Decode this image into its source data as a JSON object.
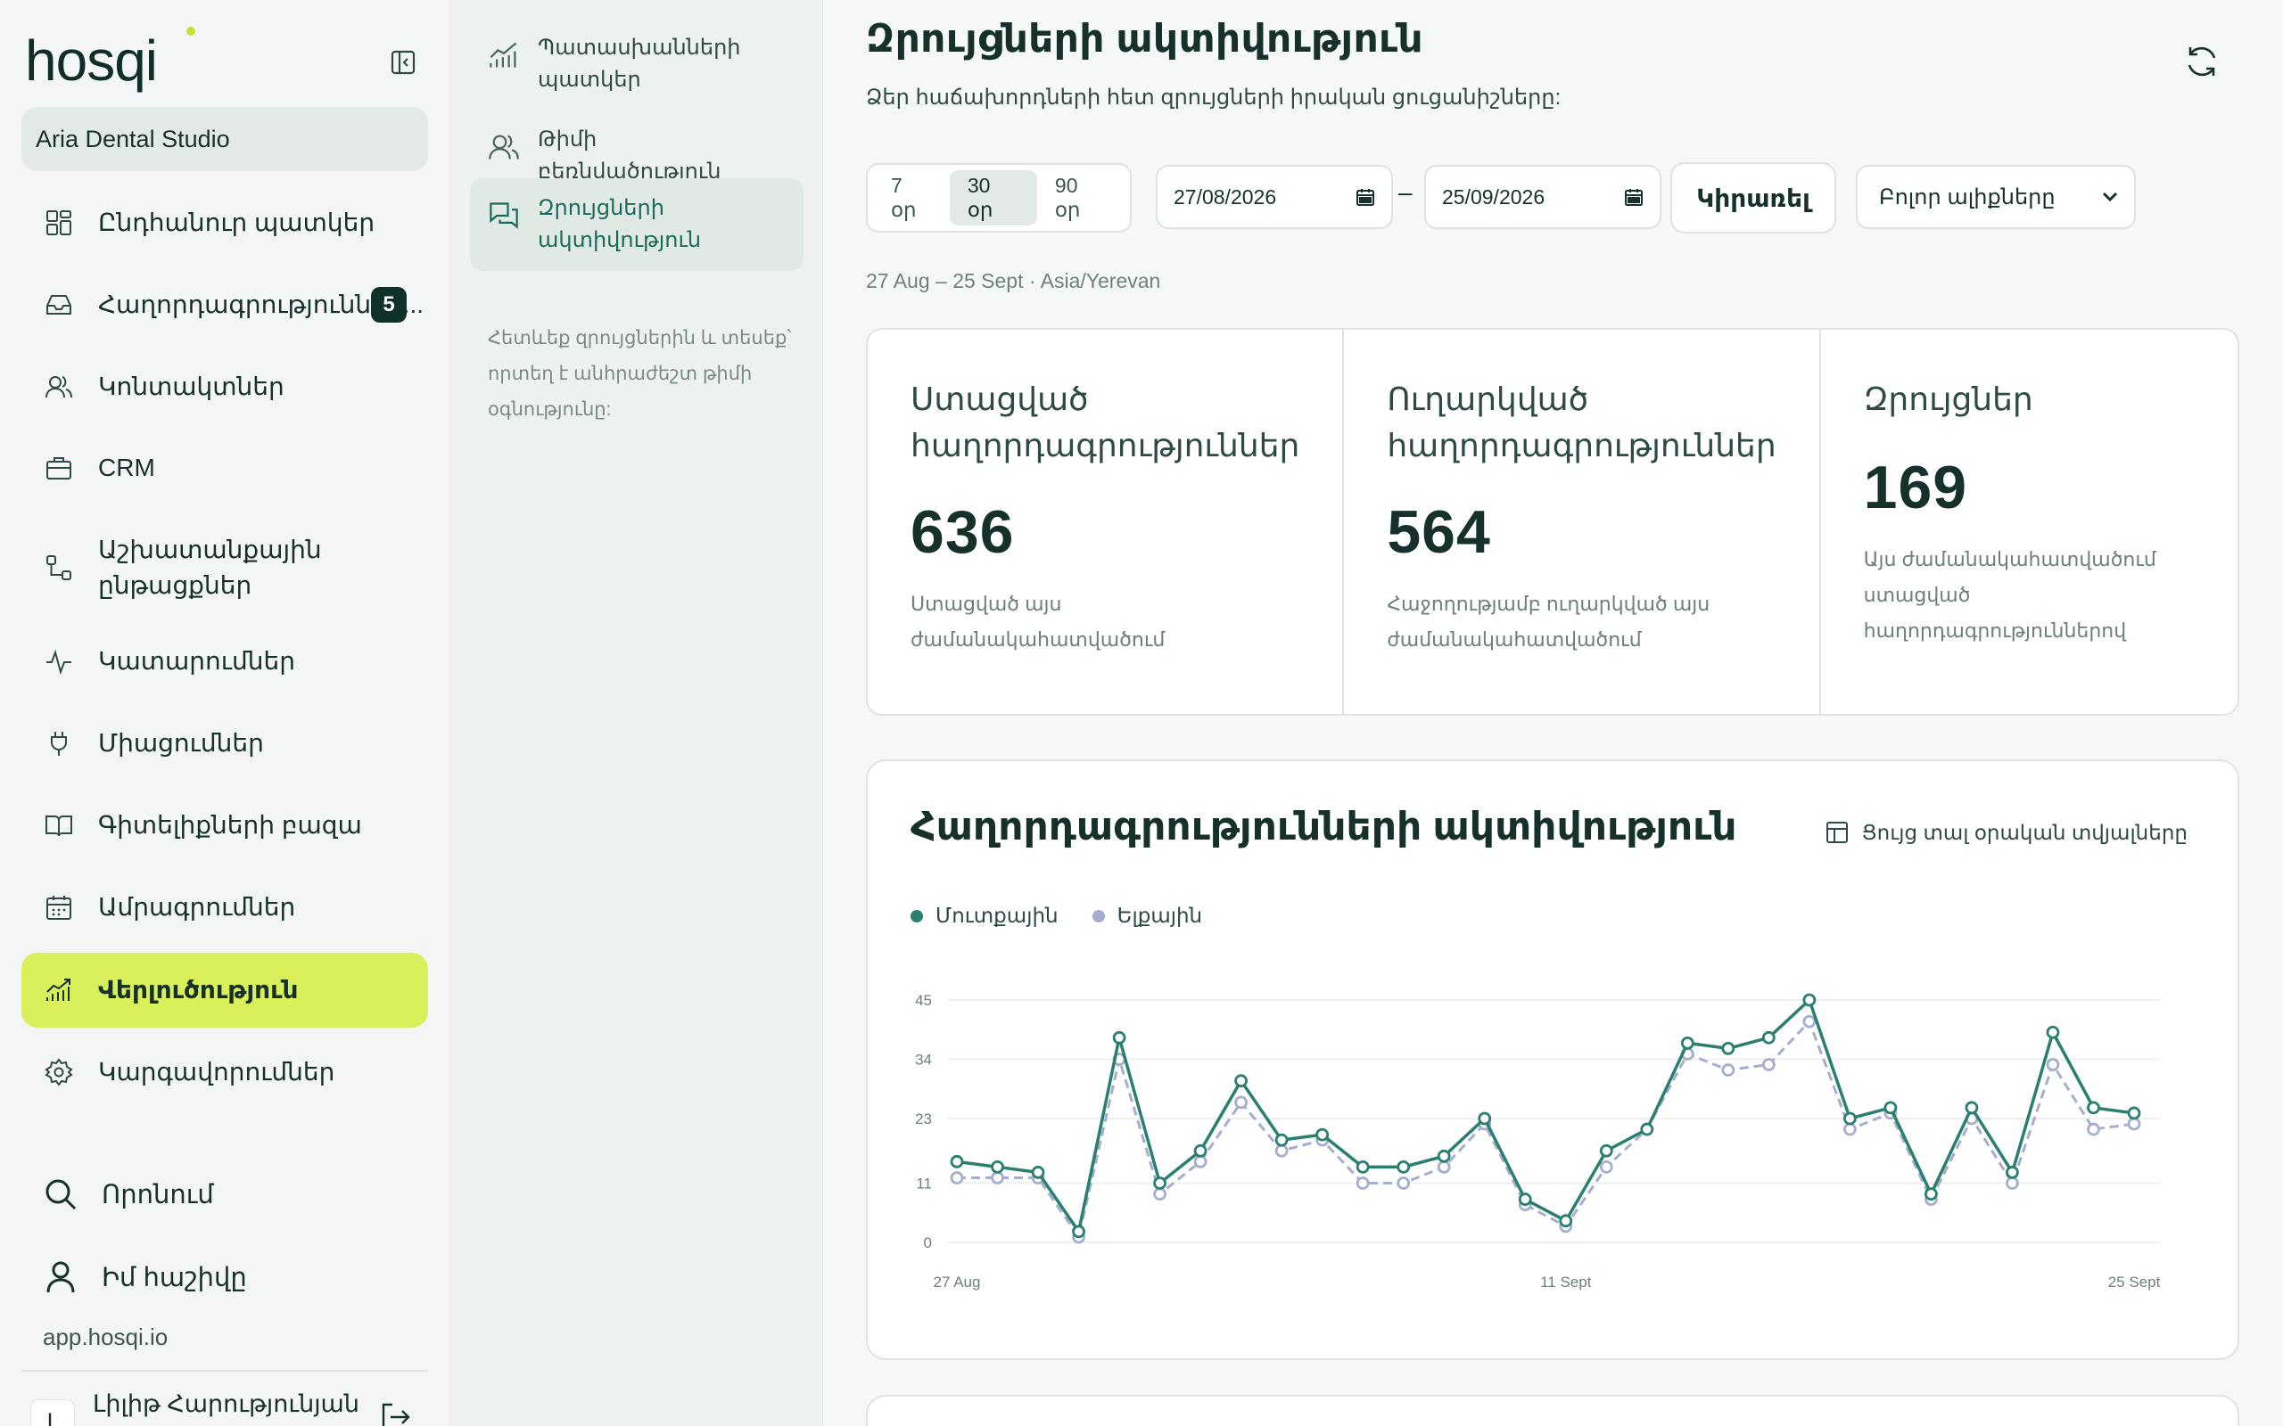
{
  "app": {
    "logo_text": "hosqi",
    "domain": "app.hosqi.io"
  },
  "workspace": {
    "name": "Aria Dental Studio"
  },
  "nav": {
    "items": [
      {
        "label": "Ընդհանուր պատկեր",
        "icon": "grid-icon"
      },
      {
        "label": "Հաղորդագրություններ...",
        "icon": "inbox-icon",
        "badge": "5"
      },
      {
        "label": "Կոնտակտներ",
        "icon": "users-icon"
      },
      {
        "label": "CRM",
        "icon": "briefcase-icon"
      },
      {
        "label": "Աշխատանքային ընթացքներ",
        "icon": "workflow-icon"
      },
      {
        "label": "Կատարումներ",
        "icon": "pulse-icon"
      },
      {
        "label": "Միացումներ",
        "icon": "plug-icon"
      },
      {
        "label": "Գիտելիքների բազա",
        "icon": "book-icon"
      },
      {
        "label": "Ամրագրումներ",
        "icon": "calendar-icon"
      },
      {
        "label": "Վերլուծություն",
        "icon": "analytics-icon",
        "active": true
      },
      {
        "label": "Կարգավորումներ",
        "icon": "gear-icon"
      }
    ],
    "search_label": "Որոնում",
    "account_label": "Իմ հաշիվը"
  },
  "user": {
    "name": "Լիլիթ Հարությունյան",
    "initial": "Լ"
  },
  "subnav": {
    "items": [
      {
        "label": "Պատասխանների պատկեր",
        "icon": "chart-icon"
      },
      {
        "label": "Թիմի բեռնվածություն",
        "icon": "team-icon"
      },
      {
        "label": "Զրույցների ակտիվություն",
        "icon": "chat-icon",
        "active": true
      }
    ],
    "help": "Հետևեք զրույցներին և տեսեք՝ որտեղ է անհրաժեշտ թիմի օգնությունը:"
  },
  "main": {
    "title": "Զրույցների ակտիվություն",
    "subtitle": "Ձեր հաճախորդների հետ զրույցների իրական ցուցանիշները:",
    "ranges": [
      "7 օր",
      "30 օր",
      "90 օր"
    ],
    "active_range": "30 օր",
    "date_from": "27/08/2026",
    "date_sep": "–",
    "date_to": "25/09/2026",
    "apply_label": "Կիրառել",
    "channel_selected": "Բոլոր ալիքները",
    "period_text": "27 Aug – 25 Sept · Asia/Yerevan"
  },
  "stats": [
    {
      "title": "Ստացված հաղորդագրություններ",
      "value": "636",
      "desc": "Ստացված այս ժամանակահատվածում"
    },
    {
      "title": "Ուղարկված հաղորդագրություններ",
      "value": "564",
      "desc": "Հաջողությամբ ուղարկված այս ժամանակահատվածում"
    },
    {
      "title": "Զրույցներ",
      "value": "169",
      "desc": "Այս ժամանակահատվածում ստացված հաղորդագրություններով"
    }
  ],
  "chart_card": {
    "title": "Հաղորդագրությունների ակտիվություն",
    "show_daily_label": "Ցույց տալ օրական տվյալները"
  },
  "colors": {
    "accent": "#d9f05a",
    "inbound": "#2a7f6f",
    "outbound": "#a6aed0",
    "dark": "#10302a"
  },
  "chart_data": {
    "type": "line",
    "x_tick_labels": [
      "27 Aug",
      "11 Sept",
      "25 Sept"
    ],
    "y_ticks": [
      0,
      11,
      23,
      34,
      45
    ],
    "ylim": [
      0,
      45
    ],
    "grid": true,
    "legend_placement": "top-left",
    "series": [
      {
        "name": "Մուտքային",
        "color": "#2a7f6f",
        "values": [
          15,
          14,
          13,
          2,
          38,
          11,
          17,
          30,
          19,
          20,
          14,
          14,
          16,
          23,
          8,
          4,
          17,
          21,
          37,
          36,
          38,
          45,
          23,
          25,
          9,
          25,
          13,
          39,
          25,
          24
        ]
      },
      {
        "name": "Ելքային",
        "color": "#a6aed0",
        "values": [
          12,
          12,
          12,
          1,
          34,
          9,
          15,
          26,
          17,
          19,
          11,
          11,
          14,
          22,
          7,
          3,
          14,
          21,
          35,
          32,
          33,
          41,
          21,
          24,
          8,
          23,
          11,
          33,
          21,
          22
        ]
      }
    ]
  }
}
